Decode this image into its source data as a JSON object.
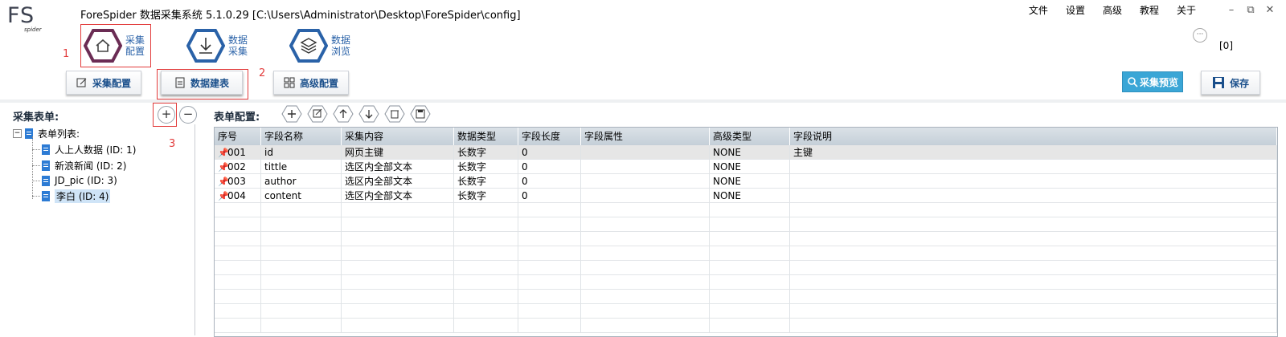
{
  "app": {
    "logo_main": "FS",
    "logo_sub": "spider",
    "title": "ForeSpider 数据采集系统  5.1.0.29  [C:\\Users\\Administrator\\Desktop\\ForeSpider\\config]"
  },
  "menu": [
    "文件",
    "设置",
    "高级",
    "教程",
    "关于"
  ],
  "window_controls": [
    "–",
    "⧉",
    "✕"
  ],
  "main_tabs": [
    {
      "line1": "采集",
      "line2": "配置"
    },
    {
      "line1": "数据",
      "line2": "采集"
    },
    {
      "line1": "数据",
      "line2": "浏览"
    }
  ],
  "sub_tabs": [
    "采集配置",
    "数据建表",
    "高级配置"
  ],
  "annotations": [
    "1",
    "2",
    "3"
  ],
  "right_buttons": {
    "preview": "采集预览",
    "save": "保存"
  },
  "notify_count": "[0]",
  "left_panel": {
    "title": "采集表单:",
    "add": "+",
    "remove": "−",
    "root": "表单列表:",
    "forms": [
      "人上人数据 (ID: 1)",
      "新浪新闻 (ID: 2)",
      "JD_pic (ID: 3)",
      "李白 (ID: 4)"
    ]
  },
  "right_panel": {
    "title": "表单配置:"
  },
  "table": {
    "columns": [
      "序号",
      "字段名称",
      "采集内容",
      "数据类型",
      "字段长度",
      "字段属性",
      "高级类型",
      "字段说明"
    ],
    "rows": [
      [
        "001",
        "id",
        "网页主键",
        "长数字",
        "0",
        "",
        "NONE",
        "主键"
      ],
      [
        "002",
        "tittle",
        "选区内全部文本",
        "长数字",
        "0",
        "",
        "NONE",
        ""
      ],
      [
        "003",
        "author",
        "选区内全部文本",
        "长数字",
        "0",
        "",
        "NONE",
        ""
      ],
      [
        "004",
        "content",
        "选区内全部文本",
        "长数字",
        "0",
        "",
        "NONE",
        ""
      ]
    ]
  },
  "colors": {
    "accent": "#2a62a8",
    "highlight_red": "#e23b3b",
    "preview_btn": "#3aa6d6"
  }
}
